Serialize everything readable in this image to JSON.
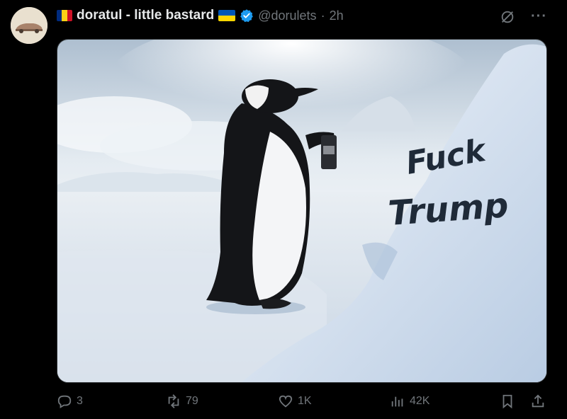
{
  "tweet": {
    "display_name": "doratul - little bastard",
    "handle": "@dorulets",
    "time": "2h",
    "separator": "·",
    "more_label": "···"
  },
  "media": {
    "snow_text_line1": "Fuck",
    "snow_text_line2": "Trump"
  },
  "actions": {
    "replies": "3",
    "reposts": "79",
    "likes": "1K",
    "views": "42K"
  },
  "colors": {
    "background": "#000000",
    "text": "#e7e9ea",
    "secondary": "#71767b",
    "verified": "#1d9bf0"
  },
  "icons": [
    "avatar-car",
    "flag-romania",
    "flag-ukraine",
    "verified-badge",
    "grok-icon",
    "more-icon",
    "reply-icon",
    "repost-icon",
    "like-icon",
    "views-icon",
    "bookmark-icon",
    "share-icon"
  ]
}
